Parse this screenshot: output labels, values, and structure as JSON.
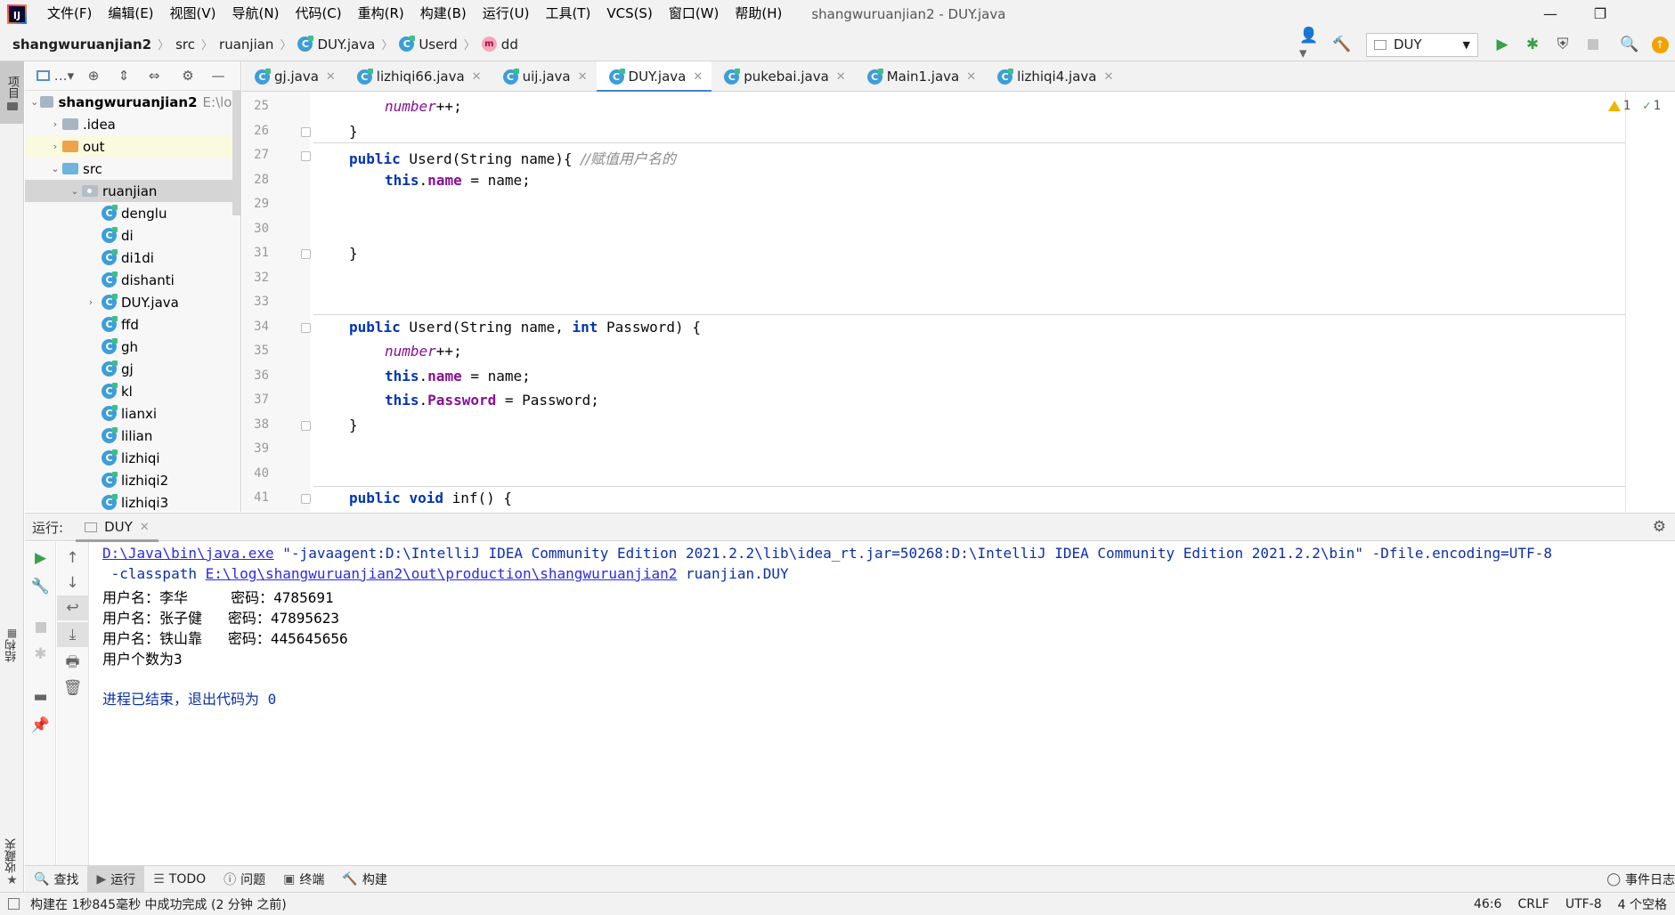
{
  "menubar": {
    "logo_text": "IJ",
    "items": [
      "文件(F)",
      "编辑(E)",
      "视图(V)",
      "导航(N)",
      "代码(C)",
      "重构(R)",
      "构建(B)",
      "运行(U)",
      "工具(T)",
      "VCS(S)",
      "窗口(W)",
      "帮助(H)"
    ],
    "window_title": "shangwuruanjian2 - DUY.java"
  },
  "breadcrumb": {
    "project": "shangwuruanjian2",
    "src": "src",
    "package": "ruanjian",
    "file": "DUY.java",
    "class": "Userd",
    "method": "dd",
    "class_icon": "C",
    "method_icon": "m"
  },
  "toolbar": {
    "run_config": "DUY"
  },
  "left_strip": {
    "project_tab": "项目",
    "structure_tab": "结构",
    "favorites_tab": "收藏夹"
  },
  "project_tree": {
    "root": "shangwuruanjian2",
    "root_path": "E:\\log",
    "items": [
      {
        "label": ".idea"
      },
      {
        "label": "out"
      },
      {
        "label": "src"
      },
      {
        "label": "ruanjian"
      },
      {
        "label": "denglu"
      },
      {
        "label": "di"
      },
      {
        "label": "di1di"
      },
      {
        "label": "dishanti"
      },
      {
        "label": "DUY.java"
      },
      {
        "label": "ffd"
      },
      {
        "label": "gh"
      },
      {
        "label": "gj"
      },
      {
        "label": "kl"
      },
      {
        "label": "lianxi"
      },
      {
        "label": "lilian"
      },
      {
        "label": "lizhiqi"
      },
      {
        "label": "lizhiqi2"
      },
      {
        "label": "lizhiqi3"
      }
    ]
  },
  "editor_tabs": [
    "gj.java",
    "lizhiqi66.java",
    "uij.java",
    "DUY.java",
    "pukebai.java",
    "Main1.java",
    "lizhiqi4.java"
  ],
  "editor": {
    "line_numbers": [
      "25",
      "26",
      "27",
      "28",
      "29",
      "30",
      "31",
      "32",
      "33",
      "34",
      "35",
      "36",
      "37",
      "38",
      "39",
      "40",
      "41"
    ],
    "warnings": "1",
    "weak_warnings": "1",
    "code": {
      "l25_field": "number",
      "l25_rest": "++;",
      "l26": "}",
      "l27_kw": "public",
      "l27_rest": " Userd(String name){ ",
      "l27_comment": "//赋值用户名的",
      "l28_kw": "this",
      "l28_dot": ".",
      "l28_field": "name",
      "l28_rest": " = name;",
      "l31": "}",
      "l34_kw": "public",
      "l34_mid": " Userd(String name, ",
      "l34_kw2": "int",
      "l34_rest": " Password) {",
      "l35_field": "number",
      "l35_rest": "++;",
      "l36_kw": "this",
      "l36_dot": ".",
      "l36_field": "name",
      "l36_rest": " = name;",
      "l37_kw": "this",
      "l37_dot": ".",
      "l37_field": "Password",
      "l37_rest": " = Password;",
      "l38": "}",
      "l41_kw": "public",
      "l41_kw2": "void",
      "l41_rest": " inf() {"
    }
  },
  "run_panel": {
    "title": "运行:",
    "tab": "DUY",
    "console": {
      "cmd_exe": "D:\\Java\\bin\\java.exe",
      "cmd_args": " \"-javaagent:D:\\IntelliJ IDEA Community Edition 2021.2.2\\lib\\idea_rt.jar=50268:D:\\IntelliJ IDEA Community Edition 2021.2.2\\bin\" -Dfile.encoding=UTF-8",
      "cp_flag": " -classpath ",
      "cp_path": "E:\\log\\shangwuruanjian2\\out\\production\\shangwuruanjian2",
      "main_class": " ruanjian.DUY",
      "out1": "用户名：李华     密码：4785691",
      "out2": "用户名：张子健   密码：47895623",
      "out3": "用户名：铁山靠   密码：445645656",
      "out4": "用户个数为3",
      "exit": "进程已结束，退出代码为 0"
    }
  },
  "bottom_tabs": [
    "查找",
    "运行",
    "TODO",
    "问题",
    "终端",
    "构建"
  ],
  "event_log": "事件日志",
  "statusbar": {
    "message": "构建在 1秒845毫秒 中成功完成 (2 分钟 之前)",
    "position": "46:6",
    "line_sep": "CRLF",
    "encoding": "UTF-8",
    "indent": "4 个空格"
  },
  "colors": {
    "accent": "#4083c9",
    "keyword": "#0033b3",
    "field": "#871094",
    "run_green": "#3aa04a"
  }
}
